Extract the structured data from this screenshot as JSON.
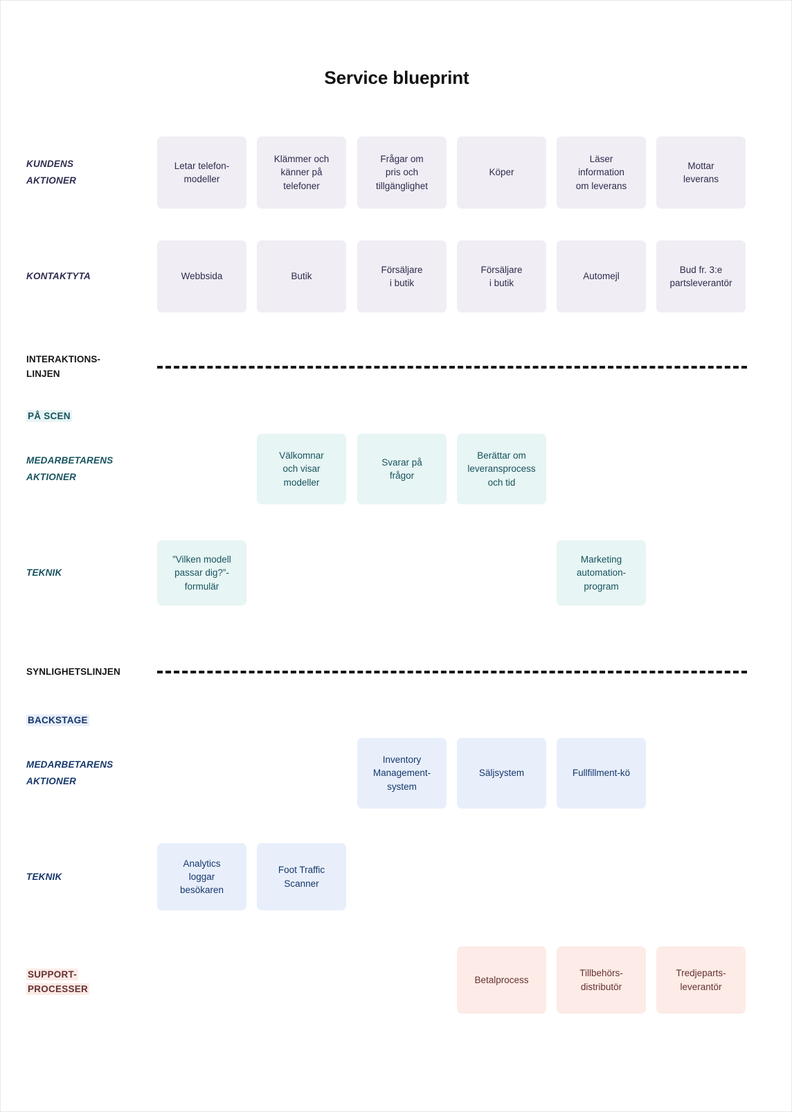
{
  "title": "Service blueprint",
  "rows": [
    {
      "key": "kundens_aktioner",
      "label": "KUNDENS\nAKTIONER",
      "label_line1": "KUNDENS",
      "label_line2": "AKTIONER",
      "theme": "customer",
      "cards": [
        {
          "col": 0,
          "text": "Letar telefon-\nmodeller",
          "lines": [
            "Letar telefon-",
            "modeller"
          ]
        },
        {
          "col": 1,
          "text": "Klämmer och\nkänner på\ntelefoner",
          "lines": [
            "Klämmer och",
            "känner på",
            "telefoner"
          ]
        },
        {
          "col": 2,
          "text": "Frågar om\npris och\ntillgänglighet",
          "lines": [
            "Frågar om",
            "pris och",
            "tillgänglighet"
          ]
        },
        {
          "col": 3,
          "text": "Köper",
          "lines": [
            "Köper"
          ]
        },
        {
          "col": 4,
          "text": "Läser\ninformation\nom leverans",
          "lines": [
            "Läser",
            "information",
            "om leverans"
          ]
        },
        {
          "col": 5,
          "text": "Mottar\nleverans",
          "lines": [
            "Mottar",
            "leverans"
          ]
        }
      ]
    },
    {
      "key": "kontaktyta",
      "label": "KONTAKTYTA",
      "label_line1": "KONTAKTYTA",
      "label_line2": "",
      "theme": "customer",
      "cards": [
        {
          "col": 0,
          "text": "Webbsida",
          "lines": [
            "Webbsida"
          ]
        },
        {
          "col": 1,
          "text": "Butik",
          "lines": [
            "Butik"
          ]
        },
        {
          "col": 2,
          "text": "Försäljare\ni butik",
          "lines": [
            "Försäljare",
            "i butik"
          ]
        },
        {
          "col": 3,
          "text": "Försäljare\ni butik",
          "lines": [
            "Försäljare",
            "i butik"
          ]
        },
        {
          "col": 4,
          "text": "Automejl",
          "lines": [
            "Automejl"
          ]
        },
        {
          "col": 5,
          "text": "Bud fr. 3:e\npartsleverantör",
          "lines": [
            "Bud fr. 3:e",
            "partsleverantör"
          ]
        }
      ]
    },
    {
      "key": "onstage_medarbetarens_aktioner",
      "label": "MEDARBETARENS\nAKTIONER",
      "label_line1": "MEDARBETARENS",
      "label_line2": "AKTIONER",
      "theme": "onstage",
      "cards": [
        {
          "col": 1,
          "text": "Välkomnar\noch visar\nmodeller",
          "lines": [
            "Välkomnar",
            "och visar",
            "modeller"
          ]
        },
        {
          "col": 2,
          "text": "Svarar på\nfrågor",
          "lines": [
            "Svarar på",
            "frågor"
          ]
        },
        {
          "col": 3,
          "text": "Berättar om\nleveransprocess\noch tid",
          "lines": [
            "Berättar om",
            "leveransprocess",
            "och tid"
          ]
        }
      ]
    },
    {
      "key": "onstage_teknik",
      "label": "TEKNIK",
      "label_line1": "TEKNIK",
      "label_line2": "",
      "theme": "onstage",
      "cards": [
        {
          "col": 0,
          "text": "”Vilken modell passar dig?”-formulär",
          "lines": [
            "”Vilken modell",
            "passar dig?”-",
            "formulär"
          ]
        },
        {
          "col": 4,
          "text": "Marketing automation-program",
          "lines": [
            "Marketing",
            "automation-",
            "program"
          ]
        }
      ]
    },
    {
      "key": "backstage_medarbetarens_aktioner",
      "label": "MEDARBETARENS\nAKTIONER",
      "label_line1": "MEDARBETARENS",
      "label_line2": "AKTIONER",
      "theme": "backstage",
      "cards": [
        {
          "col": 2,
          "text": "Inventory Management-system",
          "lines": [
            "Inventory",
            "Management-",
            "system"
          ]
        },
        {
          "col": 3,
          "text": "Säljsystem",
          "lines": [
            "Säljsystem"
          ]
        },
        {
          "col": 4,
          "text": "Fullfillment-kö",
          "lines": [
            "Fullfillment-kö"
          ]
        }
      ]
    },
    {
      "key": "backstage_teknik",
      "label": "TEKNIK",
      "label_line1": "TEKNIK",
      "label_line2": "",
      "theme": "backstage",
      "cards": [
        {
          "col": 0,
          "text": "Analytics loggar besökaren",
          "lines": [
            "Analytics",
            "loggar",
            "besökaren"
          ]
        },
        {
          "col": 1,
          "text": "Foot Traffic Scanner",
          "lines": [
            "Foot Traffic",
            "Scanner"
          ]
        }
      ]
    },
    {
      "key": "support_processer",
      "label": "",
      "label_line1": "",
      "label_line2": "",
      "theme": "support",
      "cards": [
        {
          "col": 3,
          "text": "Betalprocess",
          "lines": [
            "Betalprocess"
          ]
        },
        {
          "col": 4,
          "text": "Tillbehörs-distributör",
          "lines": [
            "Tillbehörs-",
            "distributör"
          ]
        },
        {
          "col": 5,
          "text": "Tredjeparts-leverantör",
          "lines": [
            "Tredjeparts-",
            "leverantör"
          ]
        }
      ]
    }
  ],
  "dividers": {
    "interaction": {
      "line1": "INTERAKTIONS-",
      "line2": "LINJEN"
    },
    "visibility": {
      "line1": "SYNLIGHETSLINJEN",
      "line2": ""
    }
  },
  "zones": {
    "onstage": {
      "line1": "PÅ SCEN",
      "line2": ""
    },
    "backstage": {
      "line1": "BACKSTAGE",
      "line2": ""
    },
    "support": {
      "line1": "SUPPORT-",
      "line2": "PROCESSER"
    }
  },
  "colors": {
    "customer_card": "#f0edf4",
    "customer_text": "#2e2c4e",
    "onstage_card": "#e7f5f4",
    "onstage_text": "#17535e",
    "backstage_card": "#e8effb",
    "backstage_text": "#16376c",
    "support_card": "#fcebe6",
    "support_text": "#663133",
    "line": "#17171a"
  }
}
